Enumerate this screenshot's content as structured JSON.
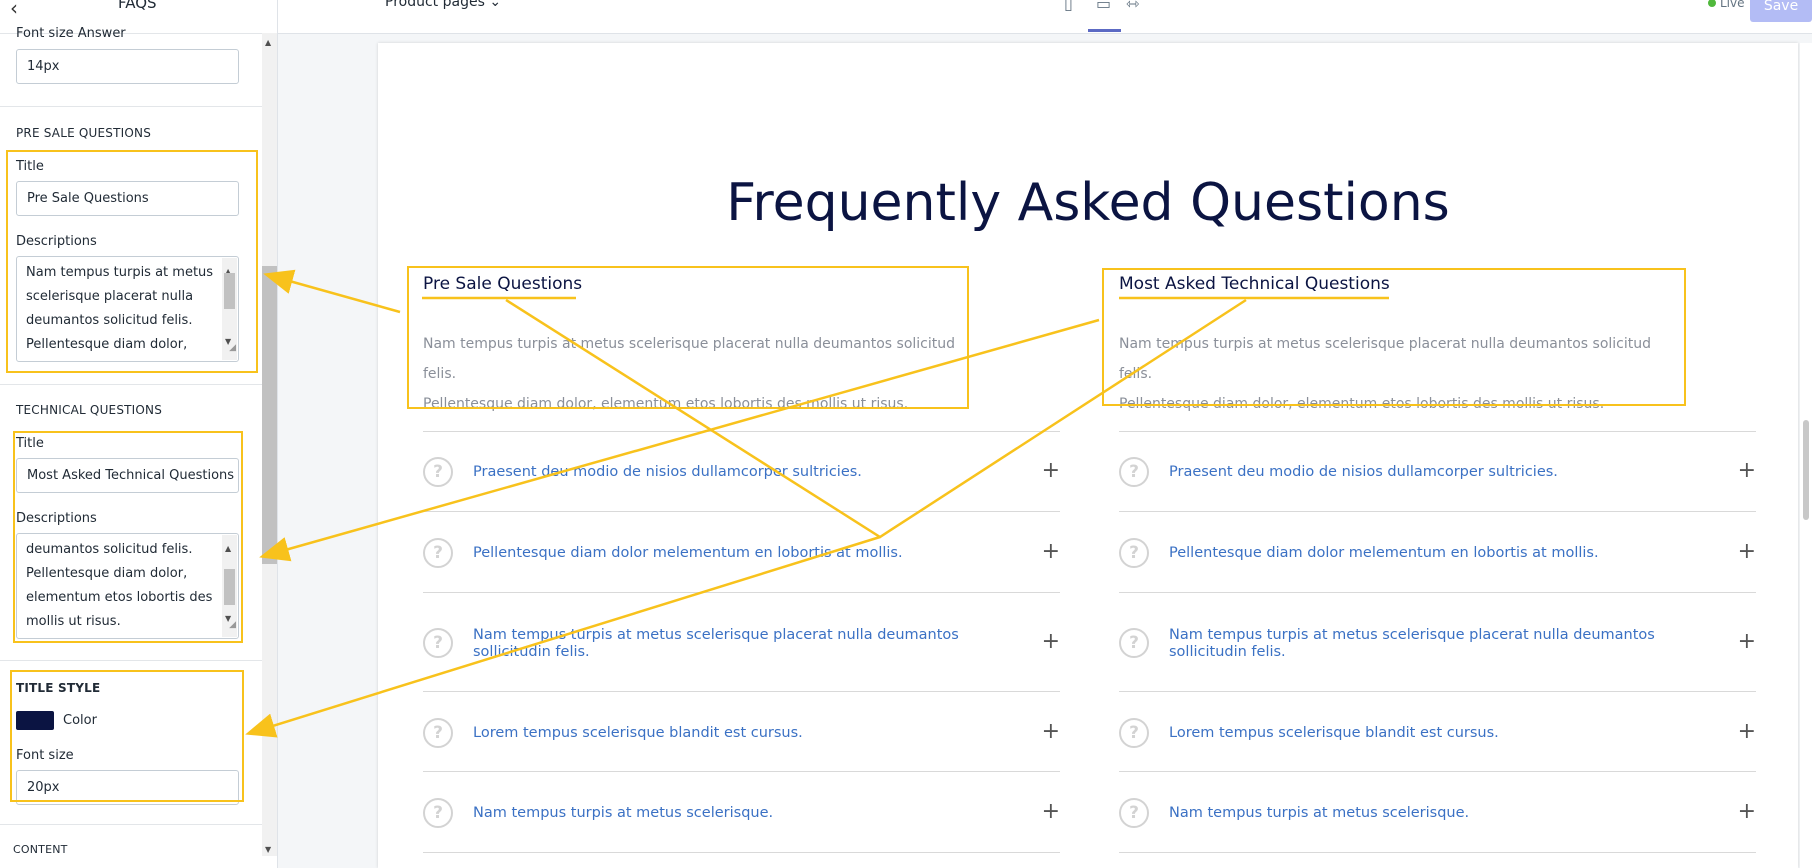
{
  "sidebar": {
    "back_glyph": "‹",
    "title": "FAQS",
    "font_size_answer_label": "Font size Answer",
    "font_size_answer_value": "14px",
    "pre_sale": {
      "section": "PRE SALE QUESTIONS",
      "title_label": "Title",
      "title_value": "Pre Sale Questions",
      "desc_label": "Descriptions",
      "desc_lines": [
        "Nam tempus turpis at metus",
        "scelerisque placerat nulla",
        "deumantos solicitud felis.",
        "Pellentesque diam dolor,"
      ]
    },
    "technical": {
      "section": "TECHNICAL QUESTIONS",
      "title_label": "Title",
      "title_value": "Most Asked Technical Questions",
      "desc_label": "Descriptions",
      "desc_lines": [
        "deumantos solicitud felis.",
        "Pellentesque diam dolor,",
        "elementum etos lobortis des",
        "mollis ut risus."
      ]
    },
    "title_style": {
      "section": "TITLE STYLE",
      "color_label": "Color",
      "color_value": "#0b1442",
      "font_size_label": "Font size",
      "font_size_value": "20px"
    },
    "content_section": "CONTENT"
  },
  "topbar": {
    "page_selector": "Product pages",
    "page_selector_icon": "chevron-down-icon",
    "devices": [
      "mobile-icon",
      "desktop-icon",
      "fullscreen-icon"
    ],
    "live_label": "Live",
    "save_label": "Save"
  },
  "preview": {
    "heading": "Frequently Asked Questions",
    "columns": [
      {
        "title": "Pre Sale Questions",
        "desc_lines": [
          "Nam tempus turpis at metus scelerisque placerat nulla deumantos solicitud felis.",
          "Pellentesque diam dolor, elementum etos lobortis des mollis ut risus."
        ],
        "faqs": [
          "Praesent deu modio de nisios dullamcorper sultricies.",
          "Pellentesque diam dolor melementum en lobortis at mollis.",
          "Nam tempus turpis at metus scelerisque placerat nulla deumantos sollicitudin felis.",
          "Lorem tempus scelerisque blandit est cursus.",
          "Nam tempus turpis at metus scelerisque."
        ]
      },
      {
        "title": "Most Asked Technical Questions",
        "desc_lines": [
          "Nam tempus turpis at metus scelerisque placerat nulla deumantos solicitud felis.",
          "Pellentesque diam dolor, elementum etos lobortis des mollis ut risus."
        ],
        "faqs": [
          "Praesent deu modio de nisios dullamcorper sultricies.",
          "Pellentesque diam dolor melementum en lobortis at mollis.",
          "Nam tempus turpis at metus scelerisque placerat nulla deumantos sollicitudin felis.",
          "Lorem tempus scelerisque blandit est cursus.",
          "Nam tempus turpis at metus scelerisque."
        ]
      }
    ],
    "question_glyph": "?",
    "plus_glyph": "+"
  },
  "colors": {
    "accent": "#5c6ac4",
    "annotation": "#f8c21c",
    "link": "#3b71c4",
    "heading": "#0b1442"
  }
}
